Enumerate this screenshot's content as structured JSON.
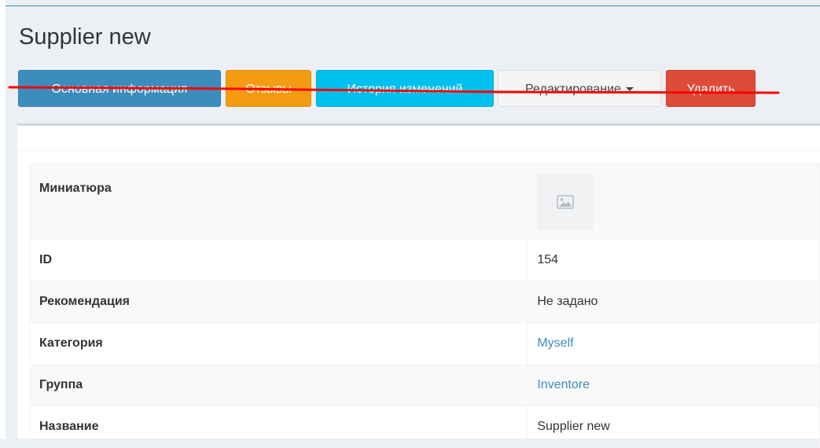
{
  "page": {
    "title": "Supplier new"
  },
  "toolbar": {
    "buttons": [
      {
        "label": "Основная информация"
      },
      {
        "label": "Отзывы"
      },
      {
        "label": "История изменений"
      },
      {
        "label": "Редактирование"
      },
      {
        "label": "Удалить"
      }
    ]
  },
  "details": {
    "rows": [
      {
        "label": "Миниатюра",
        "value": ""
      },
      {
        "label": "ID",
        "value": "154"
      },
      {
        "label": "Рекомендация",
        "value": "Не задано"
      },
      {
        "label": "Категория",
        "value": "Myself"
      },
      {
        "label": "Группа",
        "value": "Inventore"
      },
      {
        "label": "Название",
        "value": "Supplier new"
      }
    ]
  },
  "icons": {
    "thumbnail": "image-placeholder-icon",
    "dropdown": "caret-down-icon"
  },
  "colors": {
    "primary": "#3c8dbc",
    "warning": "#f39c12",
    "info": "#00c0ef",
    "danger": "#dd4b39",
    "strike": "#ff0000"
  }
}
